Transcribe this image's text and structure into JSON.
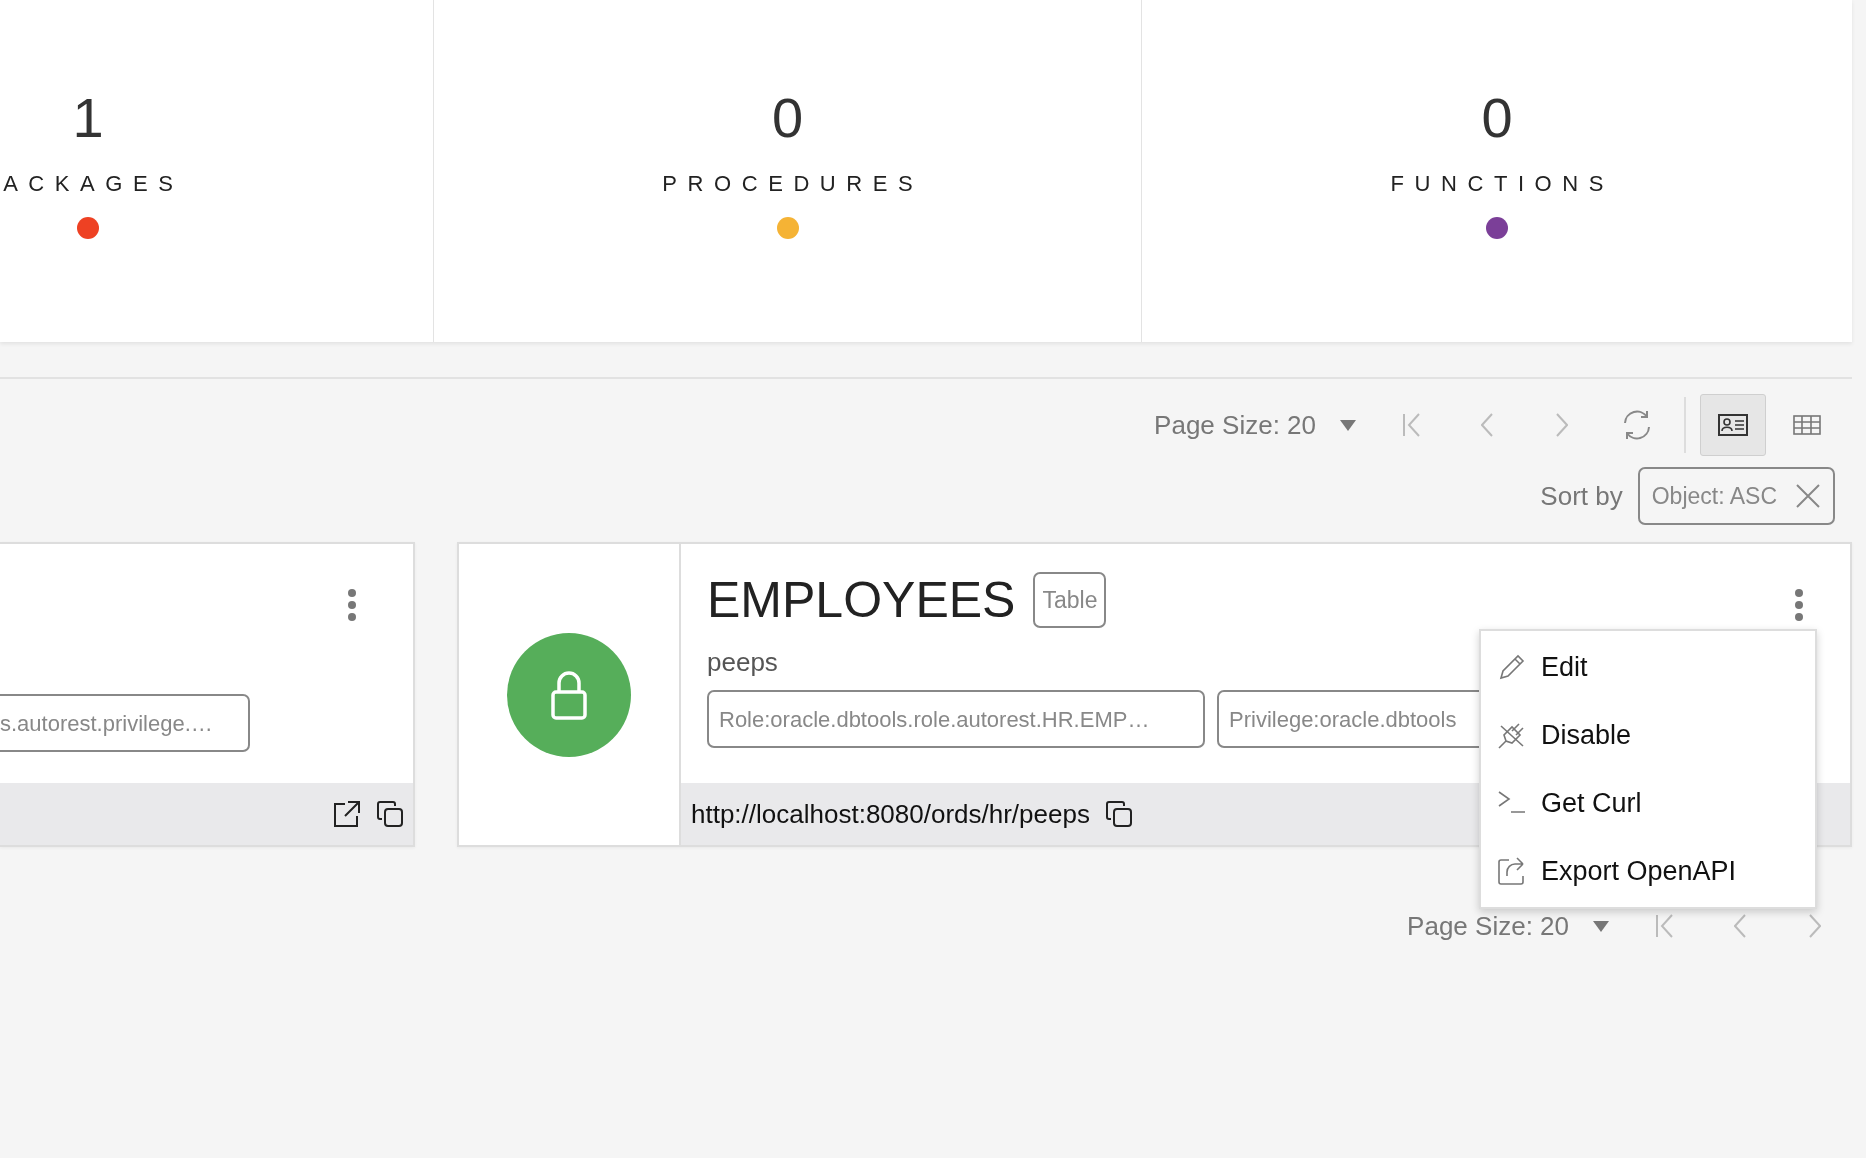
{
  "stats": [
    {
      "count": "1",
      "label": "ACKAGES",
      "color": "#ee4123"
    },
    {
      "count": "0",
      "label": "PROCEDURES",
      "color": "#f5b335"
    },
    {
      "count": "0",
      "label": "FUNCTIONS",
      "color": "#7b3f98"
    }
  ],
  "toolbar": {
    "page_size": "Page Size: 20",
    "views": [
      {
        "kind": "card",
        "selected": true
      },
      {
        "kind": "table",
        "selected": false
      }
    ]
  },
  "sort": {
    "label": "Sort by",
    "chip": "Object: ASC"
  },
  "cards": [
    {
      "tags": [
        "s.autorest.privilege.…"
      ]
    },
    {
      "title": "EMPLOYEES",
      "type": "Table",
      "subtitle": "peeps",
      "tags": [
        "Role:oracle.dbtools.role.autorest.HR.EMP…",
        "Privilege:oracle.dbtools"
      ],
      "url": "http://localhost:8080/ords/hr/peeps"
    }
  ],
  "menu": {
    "items": [
      {
        "kind": "edit",
        "label": "Edit"
      },
      {
        "kind": "disable",
        "label": "Disable"
      },
      {
        "kind": "curl",
        "label": "Get Curl"
      },
      {
        "kind": "export",
        "label": "Export OpenAPI"
      }
    ]
  },
  "bottom_pager": {
    "page_size": "Page Size: 20"
  }
}
